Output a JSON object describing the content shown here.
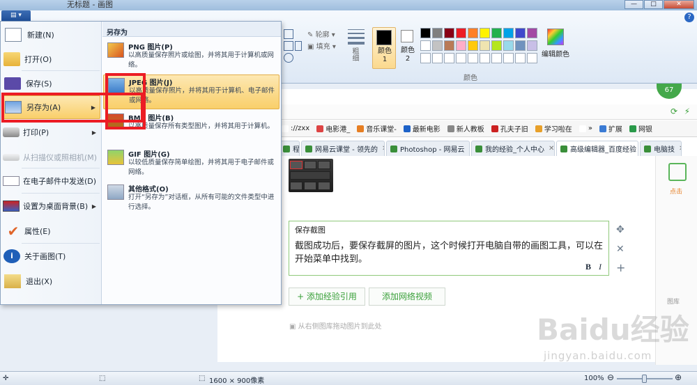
{
  "window": {
    "title": "无标题 - 画图",
    "menu_button_label": "▤ ▾",
    "minimize": "—",
    "maximize": "□",
    "close": "✕",
    "help": "?"
  },
  "ribbon": {
    "outline_label": "轮廓",
    "fill_label": "填充",
    "size_label": "粗细",
    "color1_label": "颜色 1",
    "color2_label": "颜色 2",
    "edit_colors_label": "编辑颜色",
    "colors_group_label": "颜色",
    "color1_value": "#000000",
    "color2_value": "#ffffff",
    "palette": [
      [
        "#000000",
        "#7f7f7f",
        "#880015",
        "#ed1c24",
        "#ff7f27",
        "#fff200",
        "#22b14c",
        "#00a2e8",
        "#3f48cc",
        "#a349a4"
      ],
      [
        "#ffffff",
        "#c3c3c3",
        "#b97a57",
        "#ffaec9",
        "#ffc90e",
        "#efe4b0",
        "#b5e61d",
        "#99d9ea",
        "#7092be",
        "#c8bfe7"
      ],
      [
        "#ffffff",
        "#ffffff",
        "#ffffff",
        "#ffffff",
        "#ffffff",
        "#ffffff",
        "#ffffff",
        "#ffffff",
        "#ffffff",
        "#ffffff"
      ]
    ]
  },
  "app_menu": {
    "items": [
      {
        "label": "新建(N)",
        "icon": "new-file-icon",
        "arrow": false,
        "disabled": false
      },
      {
        "label": "打开(O)",
        "icon": "open-folder-icon",
        "arrow": false,
        "disabled": false
      },
      {
        "label": "保存(S)",
        "icon": "save-disk-icon",
        "arrow": false,
        "disabled": false
      },
      {
        "label": "另存为(A)",
        "icon": "save-as-icon",
        "arrow": true,
        "disabled": false
      },
      {
        "label": "打印(P)",
        "icon": "printer-icon",
        "arrow": true,
        "disabled": false
      },
      {
        "label": "从扫描仪或照相机(M)",
        "icon": "scanner-icon",
        "arrow": false,
        "disabled": true
      },
      {
        "label": "在电子邮件中发送(D)",
        "icon": "email-icon",
        "arrow": false,
        "disabled": false
      },
      {
        "label": "设置为桌面背景(B)",
        "icon": "desktop-background-icon",
        "arrow": true,
        "disabled": false
      },
      {
        "label": "属性(E)",
        "icon": "properties-check-icon",
        "arrow": false,
        "disabled": false
      },
      {
        "label": "关于画图(T)",
        "icon": "info-icon",
        "arrow": false,
        "disabled": false
      },
      {
        "label": "退出(X)",
        "icon": "exit-icon",
        "arrow": false,
        "disabled": false
      }
    ],
    "submenu_title": "另存为",
    "formats": [
      {
        "name": "PNG 图片(P)",
        "desc": "以高质量保存照片或绘图，并将其用于计算机或网络。",
        "icon": "png-image-icon"
      },
      {
        "name": "JPEG 图片(J)",
        "desc": "以高质量保存照片，并将其用于计算机、电子邮件或网络。",
        "icon": "jpeg-image-icon"
      },
      {
        "name": "BMP 图片(B)",
        "desc": "以高质量保存所有类型图片，并将其用于计算机。",
        "icon": "bmp-image-icon"
      },
      {
        "name": "GIF 图片(G)",
        "desc": "以较低质量保存简单绘图，并将其用于电子邮件或网络。",
        "icon": "gif-image-icon"
      },
      {
        "name": "其他格式(O)",
        "desc": "打开“另存为”对话框，从所有可能的文件类型中进行选择。",
        "icon": "other-formats-icon"
      }
    ]
  },
  "browser": {
    "bookmarks": [
      "://zxx",
      "电影港_",
      "音乐课堂-",
      "最新电影",
      "新人教板",
      "孔夫子旧",
      "学习啦在",
      "»",
      "扩展",
      "网银"
    ],
    "bookmark_colors": [
      "#ffffff",
      "#d44",
      "#e67e22",
      "#1e62c8",
      "#888",
      "#c22",
      "#e8a02a",
      "#ffffff",
      "#3b7bd4",
      "#2a9a4a"
    ],
    "tabs": [
      {
        "label": "程序",
        "active": false
      },
      {
        "label": "网易云课堂 - 领先的",
        "active": false
      },
      {
        "label": "Photoshop - 网易云",
        "active": false
      },
      {
        "label": "我的经验_个人中心",
        "active": false
      },
      {
        "label": "高级编辑器_百度经验",
        "active": true
      },
      {
        "label": "电脑技",
        "active": false
      }
    ],
    "close_glyph": "✕",
    "badge": "67",
    "editor": {
      "title": "保存截图",
      "body": "截图成功后，要保存截屏的图片，这个时候打开电脑自带的画图工具，可以在开始菜单中找到。",
      "bold": "B",
      "italic": "I"
    },
    "add_experience_ref": "+ 添加经验引用",
    "add_video": "添加网络视频",
    "drag_hint": "从右侧图库拖动图片到此处",
    "side_label": "点击",
    "gallery_label": "图库",
    "watermark_main": "Baidu经验",
    "watermark_url": "jingyan.baidu.com"
  },
  "statusbar": {
    "dimensions": "1600 × 900像素",
    "zoom": "100%",
    "zoom_level": 0.5
  }
}
